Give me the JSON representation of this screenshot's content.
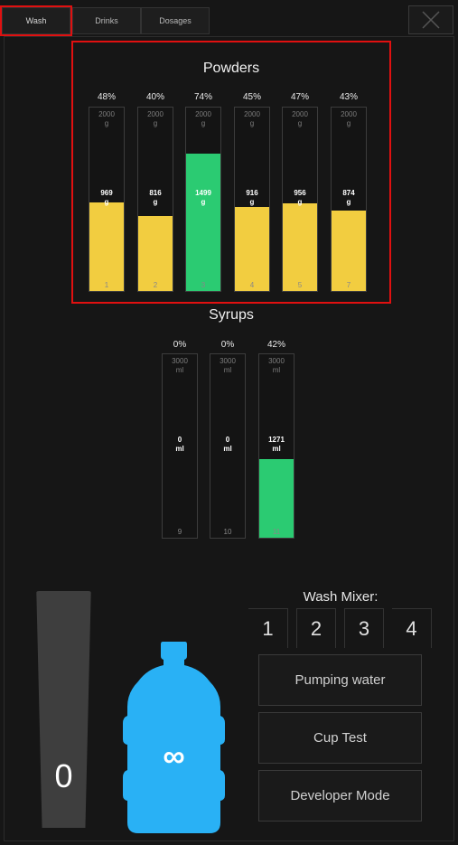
{
  "tabs": [
    {
      "label": "Wash"
    },
    {
      "label": "Drinks"
    },
    {
      "label": "Dosages"
    }
  ],
  "powders": {
    "title": "Powders",
    "items": [
      {
        "pct": "48%",
        "capacity": "2000",
        "cap_unit": "g",
        "amount": "969",
        "amount_unit": "g",
        "number": "1",
        "level": 0.485,
        "color": "#f2cd40"
      },
      {
        "pct": "40%",
        "capacity": "2000",
        "cap_unit": "g",
        "amount": "816",
        "amount_unit": "g",
        "number": "2",
        "level": 0.41,
        "color": "#f2cd40"
      },
      {
        "pct": "74%",
        "capacity": "2000",
        "cap_unit": "g",
        "amount": "1499",
        "amount_unit": "g",
        "number": "3",
        "level": 0.75,
        "color": "#2bcb72"
      },
      {
        "pct": "45%",
        "capacity": "2000",
        "cap_unit": "g",
        "amount": "916",
        "amount_unit": "g",
        "number": "4",
        "level": 0.46,
        "color": "#f2cd40"
      },
      {
        "pct": "47%",
        "capacity": "2000",
        "cap_unit": "g",
        "amount": "956",
        "amount_unit": "g",
        "number": "5",
        "level": 0.48,
        "color": "#f2cd40"
      },
      {
        "pct": "43%",
        "capacity": "2000",
        "cap_unit": "g",
        "amount": "874",
        "amount_unit": "g",
        "number": "7",
        "level": 0.44,
        "color": "#f2cd40"
      }
    ]
  },
  "syrups": {
    "title": "Syrups",
    "items": [
      {
        "pct": "0%",
        "capacity": "3000",
        "cap_unit": "ml",
        "amount": "0",
        "amount_unit": "ml",
        "number": "9",
        "level": 0,
        "color": "#2bcb72"
      },
      {
        "pct": "0%",
        "capacity": "3000",
        "cap_unit": "ml",
        "amount": "0",
        "amount_unit": "ml",
        "number": "10",
        "level": 0,
        "color": "#2bcb72"
      },
      {
        "pct": "42%",
        "capacity": "3000",
        "cap_unit": "ml",
        "amount": "1271",
        "amount_unit": "ml",
        "number": "11",
        "level": 0.43,
        "color": "#2bcb72"
      }
    ]
  },
  "cups": {
    "count": "0",
    "icon": "cup-stack-icon"
  },
  "water": {
    "label": "∞",
    "icon": "water-bottle-icon",
    "color": "#29b1f5"
  },
  "wash_mixer": {
    "title": "Wash Mixer:",
    "buttons": [
      "1",
      "2",
      "3",
      "4"
    ]
  },
  "actions": {
    "pumping": "Pumping water",
    "cup_test": "Cup Test",
    "developer": "Developer Mode"
  },
  "colors": {
    "highlight": "#e01010",
    "yellow": "#f2cd40",
    "green": "#2bcb72",
    "blue": "#29b1f5"
  }
}
